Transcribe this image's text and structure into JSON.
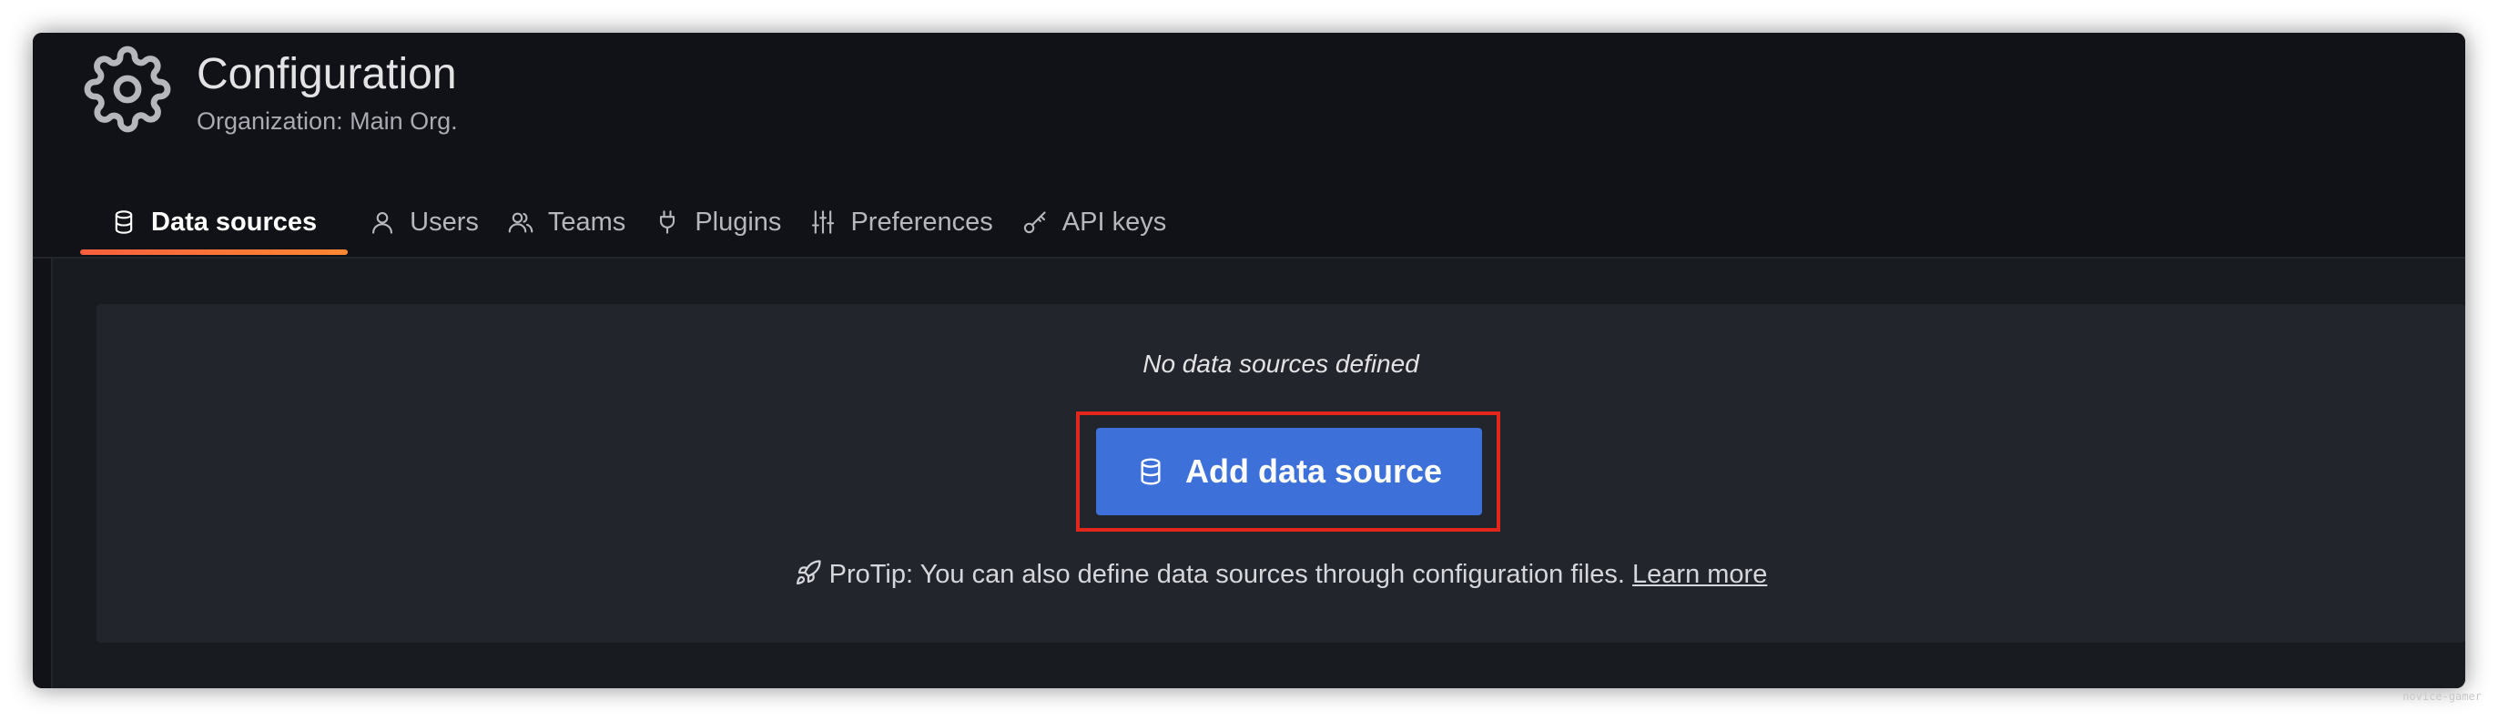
{
  "header": {
    "title": "Configuration",
    "subtitle": "Organization: Main Org.",
    "icon": "gear-icon"
  },
  "tabs": [
    {
      "label": "Data sources",
      "icon": "database-icon",
      "active": true
    },
    {
      "label": "Users",
      "icon": "user-icon",
      "active": false
    },
    {
      "label": "Teams",
      "icon": "users-icon",
      "active": false
    },
    {
      "label": "Plugins",
      "icon": "plug-icon",
      "active": false
    },
    {
      "label": "Preferences",
      "icon": "sliders-icon",
      "active": false
    },
    {
      "label": "API keys",
      "icon": "key-icon",
      "active": false
    }
  ],
  "empty_state": {
    "message": "No data sources defined",
    "button_label": "Add data source",
    "button_icon": "database-icon",
    "protip_text": "ProTip: You can also define data sources through configuration files.",
    "protip_icon": "rocket-icon",
    "learn_more": "Learn more"
  },
  "watermark": "novice-gamer",
  "colors": {
    "background": "#111217",
    "panel": "#22252b",
    "primary_button": "#3d71d9",
    "active_tab_accent": "#f55f3e",
    "highlight_box": "#e1261b"
  }
}
